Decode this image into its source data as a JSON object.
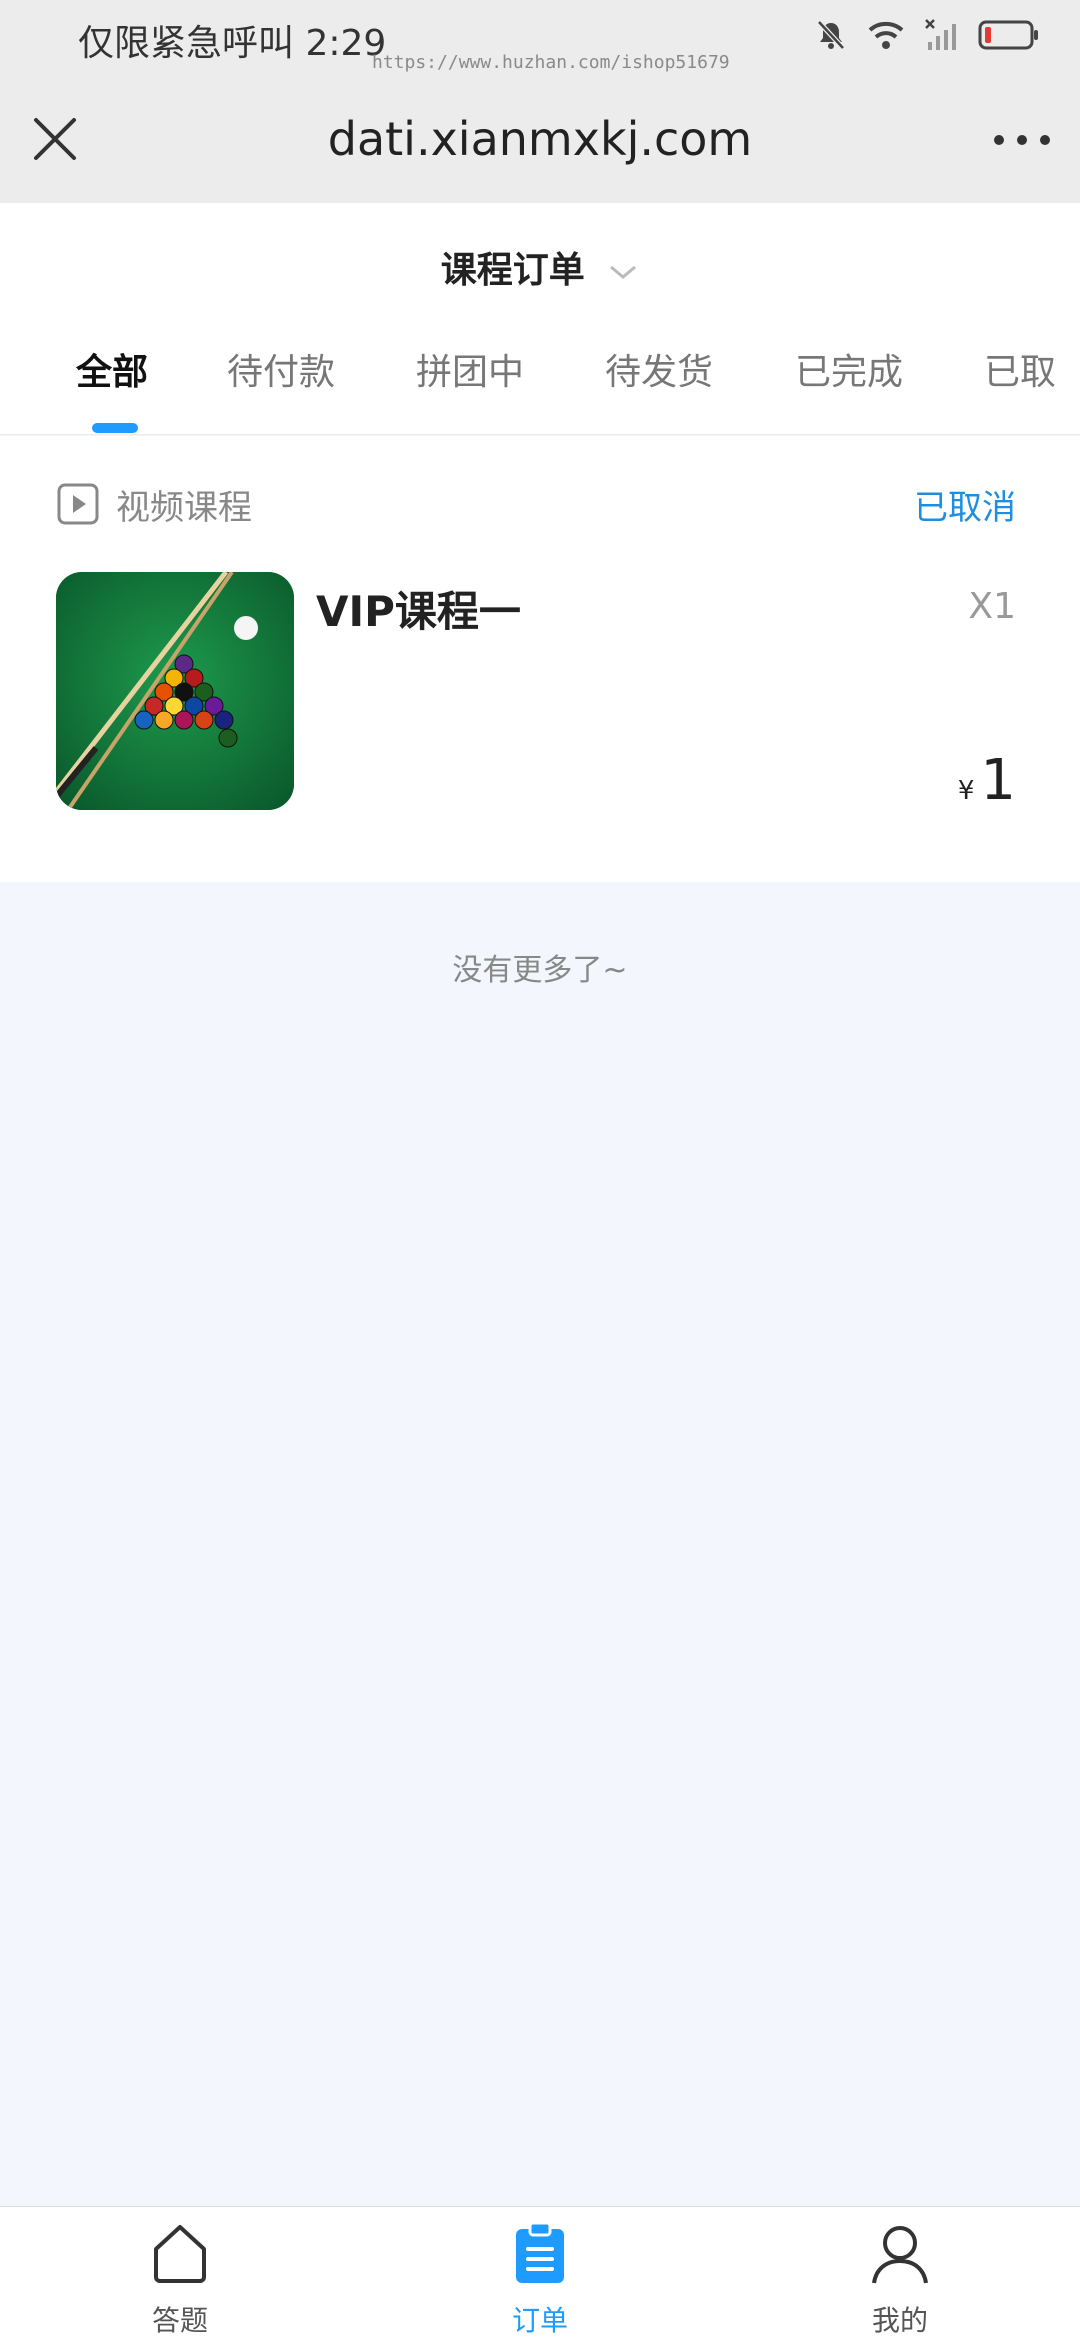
{
  "status_bar": {
    "carrier_time": "仅限紧急呼叫 2:29",
    "watermark": "https://www.huzhan.com/ishop51679"
  },
  "browser": {
    "url": "dati.xianmxkj.com",
    "close_icon": "close-icon",
    "more_icon": "more-dots-icon"
  },
  "header": {
    "title": "课程订单",
    "tabs": [
      "全部",
      "待付款",
      "拼团中",
      "待发货",
      "已完成",
      "已取"
    ],
    "active_tab": 0
  },
  "order": {
    "category": "视频课程",
    "status": "已取消",
    "product_title": "VIP课程一",
    "quantity": "X1",
    "currency": "¥",
    "price": "1"
  },
  "footer_note": "没有更多了~",
  "bottom_nav": {
    "items": [
      {
        "label": "答题",
        "icon": "home-icon"
      },
      {
        "label": "订单",
        "icon": "clipboard-icon"
      },
      {
        "label": "我的",
        "icon": "user-icon"
      }
    ],
    "active": 1
  },
  "colors": {
    "accent": "#1e9bff",
    "status_cancelled": "#1e8fe0",
    "page_bg": "#f3f6fc"
  }
}
